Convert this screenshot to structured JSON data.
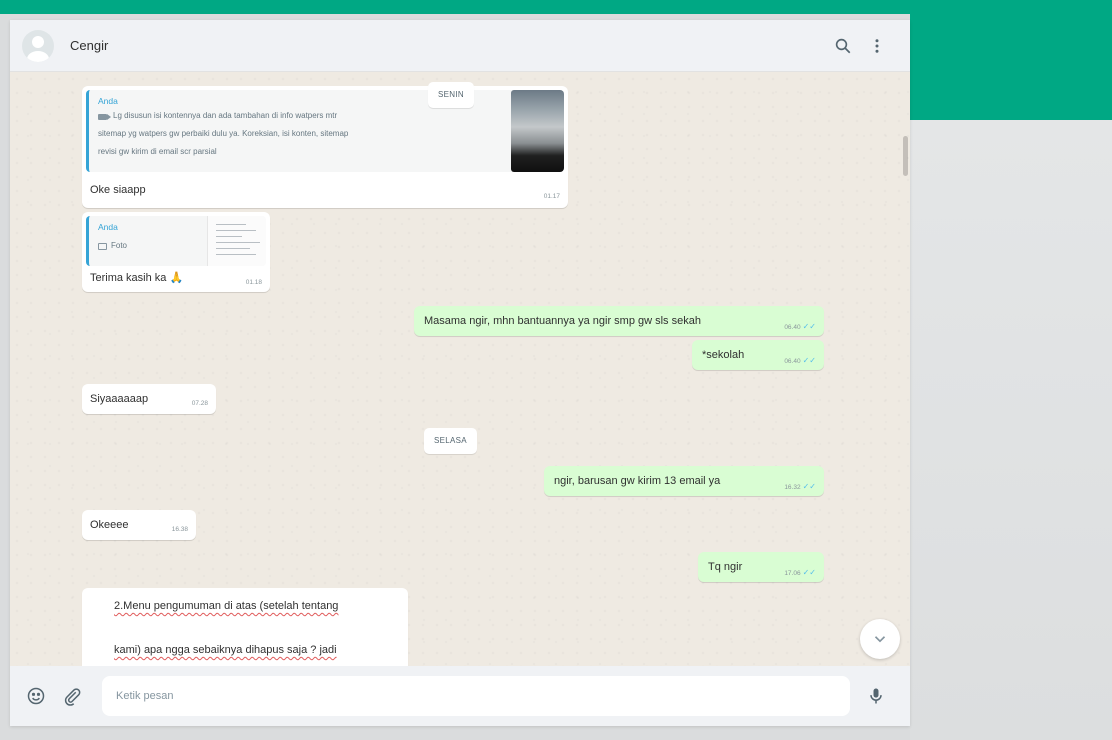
{
  "header": {
    "contact_name": "Cengir",
    "search_icon": "search-icon",
    "menu_icon": "vertical-dots-menu-icon"
  },
  "chat": {
    "days": {
      "monday": "SENIN",
      "tuesday": "SELASA"
    },
    "messages": {
      "m1": {
        "direction": "in",
        "quote_author": "Anda",
        "quote_line1": "Lg disusun isi kontennya dan ada tambahan di info watpers mtr",
        "quote_line2": "sitemap yg watpers gw perbaiki dulu ya. Koreksian, isi konten, sitemap",
        "quote_line3": "revisi gw kirim di email scr parsial",
        "text": "Oke siaapp",
        "time": "01.17"
      },
      "m2": {
        "direction": "in",
        "quote_author": "Anda",
        "quote_label": "Foto",
        "text": "Terima kasih ka",
        "emoji": "🙏",
        "time": "01.18"
      },
      "m3": {
        "direction": "out",
        "text": "Masama ngir, mhn bantuannya ya ngir smp gw sls sekah",
        "time": "06.40"
      },
      "m4": {
        "direction": "out",
        "text": "*sekolah",
        "time": "06.40"
      },
      "m5": {
        "direction": "in",
        "text": "Siyaaaaaap",
        "time": "07.28"
      },
      "m6": {
        "direction": "out",
        "text": "ngir, barusan gw kirim 13 email ya",
        "time": "16.32"
      },
      "m7": {
        "direction": "in",
        "text": "Okeeee",
        "time": "16.38"
      },
      "m8": {
        "direction": "out",
        "text": "Tq ngir",
        "time": "17.06"
      },
      "m9": {
        "direction": "in",
        "line1": "2.Menu pengumuman di atas (setelah tentang",
        "line2": "kami) apa ngga sebaiknya dihapus saja ? jadi"
      }
    }
  },
  "footer": {
    "placeholder": "Ketik pesan",
    "emoji_icon": "emoji-smiley-icon",
    "attach_icon": "paperclip-icon",
    "mic_icon": "microphone-icon"
  },
  "colors": {
    "brand_green": "#00a884",
    "outgoing_bubble": "#d9fdd3",
    "incoming_bubble": "#ffffff",
    "quote_accent": "#35a4d6",
    "read_tick": "#53bdeb"
  }
}
